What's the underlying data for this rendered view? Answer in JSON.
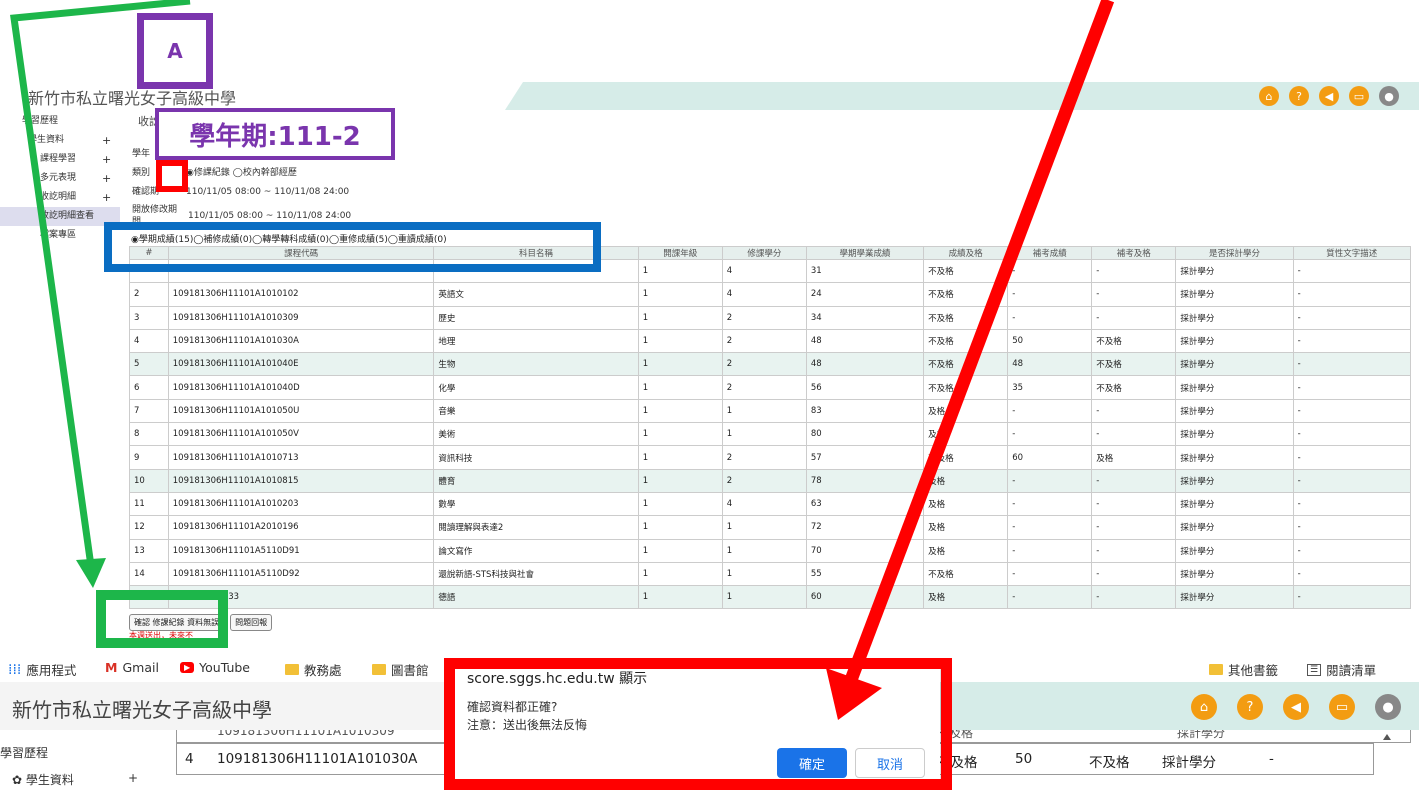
{
  "top_window": {
    "title": "新竹市私立曙光女子高級中學",
    "header_icons": [
      "home-icon",
      "help-icon",
      "speaker-icon",
      "chat-icon",
      "user-icon"
    ],
    "sidebar": {
      "items": [
        {
          "label": "學習歷程",
          "plus": ""
        },
        {
          "label": "學生資料",
          "plus": "+"
        },
        {
          "label": "課程學習",
          "plus": "+"
        },
        {
          "label": "多元表現",
          "plus": "+"
        },
        {
          "label": "收訖明細",
          "plus": "+"
        },
        {
          "label": "收訖明細查看",
          "plus": ""
        },
        {
          "label": "檔案專區",
          "plus": ""
        }
      ]
    },
    "tab_label": "收訖",
    "form": {
      "row1_label": "學年",
      "category_label": "類別",
      "category_options": [
        "修課紀錄",
        "校內幹部經歷"
      ],
      "confirm_label": "確認期",
      "confirm_value": "110/11/05 08:00 ~ 110/11/08 24:00",
      "open_label": "開放修改期間",
      "open_value": "110/11/05 08:00 ~ 110/11/08 24:00"
    },
    "grade_radios": [
      "學期成績(15)",
      "補修成績(0)",
      "轉學轉科成績(0)",
      "重修成績(5)",
      "重讀成績(0)"
    ],
    "table": {
      "headers": [
        "#",
        "課程代碼",
        "科目名稱",
        "開課年級",
        "修課學分",
        "學期學業成績",
        "成績及格",
        "補考成績",
        "補考及格",
        "是否採計學分",
        "質性文字描述"
      ],
      "rows": [
        [
          "",
          "",
          "",
          "1",
          "4",
          "31",
          "不及格",
          "-",
          "-",
          "採計學分",
          "-"
        ],
        [
          "2",
          "109181306H11101A1010102",
          "英語文",
          "1",
          "4",
          "24",
          "不及格",
          "-",
          "-",
          "採計學分",
          "-"
        ],
        [
          "3",
          "109181306H11101A1010309",
          "歷史",
          "1",
          "2",
          "34",
          "不及格",
          "-",
          "-",
          "採計學分",
          "-"
        ],
        [
          "4",
          "109181306H11101A101030A",
          "地理",
          "1",
          "2",
          "48",
          "不及格",
          "50",
          "不及格",
          "採計學分",
          "-"
        ],
        [
          "5",
          "109181306H11101A101040E",
          "生物",
          "1",
          "2",
          "48",
          "不及格",
          "48",
          "不及格",
          "採計學分",
          "-"
        ],
        [
          "6",
          "109181306H11101A101040D",
          "化學",
          "1",
          "2",
          "56",
          "不及格",
          "35",
          "不及格",
          "採計學分",
          "-"
        ],
        [
          "7",
          "109181306H11101A101050U",
          "音樂",
          "1",
          "1",
          "83",
          "及格",
          "-",
          "-",
          "採計學分",
          "-"
        ],
        [
          "8",
          "109181306H11101A101050V",
          "美術",
          "1",
          "1",
          "80",
          "及格",
          "-",
          "-",
          "採計學分",
          "-"
        ],
        [
          "9",
          "109181306H11101A1010713",
          "資訊科技",
          "1",
          "2",
          "57",
          "不及格",
          "60",
          "及格",
          "採計學分",
          "-"
        ],
        [
          "10",
          "109181306H11101A1010815",
          "體育",
          "1",
          "2",
          "78",
          "及格",
          "-",
          "-",
          "採計學分",
          "-"
        ],
        [
          "11",
          "109181306H11101A1010203",
          "數學",
          "1",
          "4",
          "63",
          "及格",
          "-",
          "-",
          "採計學分",
          "-"
        ],
        [
          "12",
          "109181306H11101A2010196",
          "閱讀理解與表達2",
          "1",
          "1",
          "72",
          "及格",
          "-",
          "-",
          "採計學分",
          "-"
        ],
        [
          "13",
          "109181306H11101A5110D91",
          "論文寫作",
          "1",
          "1",
          "70",
          "及格",
          "-",
          "-",
          "採計學分",
          "-"
        ],
        [
          "14",
          "109181306H11101A5110D92",
          "還說新語-STS科技與社會",
          "1",
          "1",
          "55",
          "不及格",
          "-",
          "-",
          "採計學分",
          "-"
        ],
        [
          "",
          "1101A5110H33",
          "德語",
          "1",
          "1",
          "60",
          "及格",
          "-",
          "-",
          "採計學分",
          "-"
        ]
      ]
    },
    "buttons": [
      "確認 修課紀錄 資料無誤",
      "問題回報"
    ],
    "red_text": "本週送出，未來不"
  },
  "bookmarks": [
    {
      "label": "應用程式",
      "icon": "apps-grid-icon"
    },
    {
      "label": "Gmail",
      "icon": "gmail-icon"
    },
    {
      "label": "YouTube",
      "icon": "youtube-icon"
    },
    {
      "label": "教務處",
      "icon": "folder-icon"
    },
    {
      "label": "圖書館",
      "icon": "folder-icon"
    },
    {
      "label": "其他書籤",
      "icon": "folder-icon"
    },
    {
      "label": "閱讀清單",
      "icon": "reading-list-icon"
    }
  ],
  "bottom_window": {
    "title": "新竹市私立曙光女子高級中學",
    "sidebar_heading": "學習歷程",
    "sidebar_item": "學生資料",
    "sidebar_plus": "+",
    "row_partial": "109181306H11101A1010309",
    "row_partial_grade": "不及格",
    "row_partial_credit": "採計學分",
    "row": [
      "4",
      "109181306H11101A101030A",
      "不及格",
      "50",
      "不及格",
      "採計學分",
      "-"
    ]
  },
  "dialog": {
    "origin": "score.sggs.hc.edu.tw 顯示",
    "message1": "確認資料都正確?",
    "message2": "注意：送出後無法反悔",
    "ok": "確定",
    "cancel": "取消"
  },
  "annotations": {
    "label_a": "A",
    "term": "學年期:111-2",
    "colors": {
      "purple": "#7a35ad",
      "red": "#ff0000",
      "blue": "#0a6dc2",
      "green": "#1db64a"
    }
  }
}
